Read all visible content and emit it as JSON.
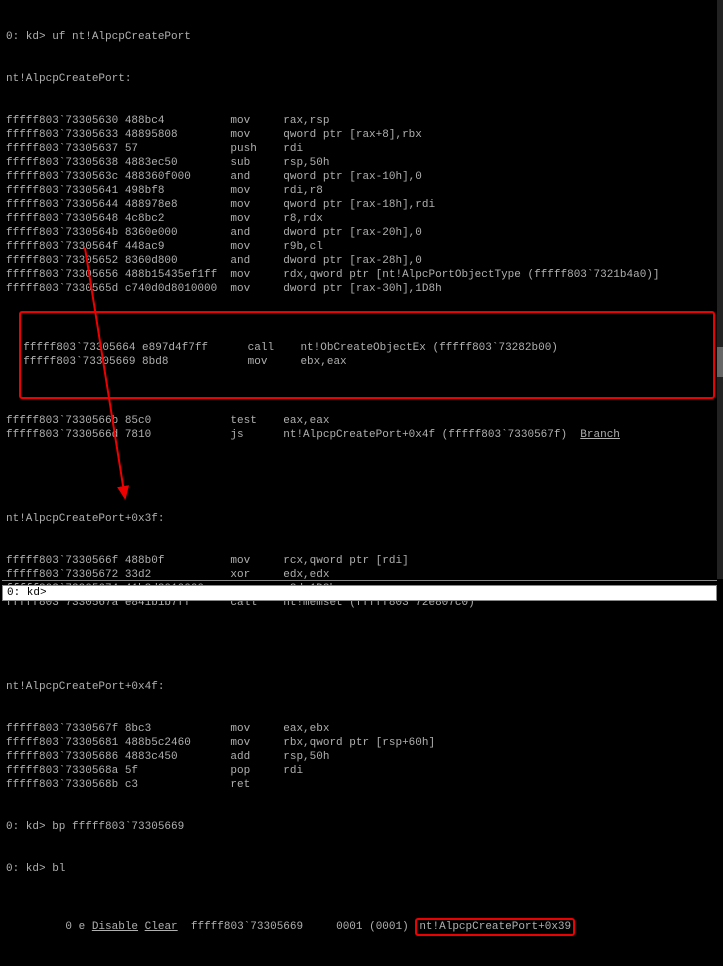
{
  "prompt0": "0: kd> uf nt!AlpcpCreatePort",
  "header": "nt!AlpcpCreatePort:",
  "rows": [
    {
      "addr": "fffff803`73305630",
      "bytes": "488bc4",
      "mn": "mov",
      "ops": "rax,rsp"
    },
    {
      "addr": "fffff803`73305633",
      "bytes": "48895808",
      "mn": "mov",
      "ops": "qword ptr [rax+8],rbx"
    },
    {
      "addr": "fffff803`73305637",
      "bytes": "57",
      "mn": "push",
      "ops": "rdi"
    },
    {
      "addr": "fffff803`73305638",
      "bytes": "4883ec50",
      "mn": "sub",
      "ops": "rsp,50h"
    },
    {
      "addr": "fffff803`7330563c",
      "bytes": "488360f000",
      "mn": "and",
      "ops": "qword ptr [rax-10h],0"
    },
    {
      "addr": "fffff803`73305641",
      "bytes": "498bf8",
      "mn": "mov",
      "ops": "rdi,r8"
    },
    {
      "addr": "fffff803`73305644",
      "bytes": "488978e8",
      "mn": "mov",
      "ops": "qword ptr [rax-18h],rdi"
    },
    {
      "addr": "fffff803`73305648",
      "bytes": "4c8bc2",
      "mn": "mov",
      "ops": "r8,rdx"
    },
    {
      "addr": "fffff803`7330564b",
      "bytes": "8360e000",
      "mn": "and",
      "ops": "dword ptr [rax-20h],0"
    },
    {
      "addr": "fffff803`7330564f",
      "bytes": "448ac9",
      "mn": "mov",
      "ops": "r9b,cl"
    },
    {
      "addr": "fffff803`73305652",
      "bytes": "8360d800",
      "mn": "and",
      "ops": "dword ptr [rax-28h],0"
    },
    {
      "addr": "fffff803`73305656",
      "bytes": "488b15435ef1ff",
      "mn": "mov",
      "ops": "rdx,qword ptr [nt!AlpcPortObjectType (fffff803`7321b4a0)]"
    },
    {
      "addr": "fffff803`7330565d",
      "bytes": "c740d0d8010000",
      "mn": "mov",
      "ops": "dword ptr [rax-30h],1D8h"
    }
  ],
  "box1": [
    {
      "addr": "fffff803`73305664",
      "bytes": "e897d4f7ff",
      "mn": "call",
      "ops": "nt!ObCreateObjectEx (fffff803`73282b00)"
    },
    {
      "addr": "fffff803`73305669",
      "bytes": "8bd8",
      "mn": "mov",
      "ops": "ebx,eax"
    }
  ],
  "rows2": [
    {
      "addr": "fffff803`7330566b",
      "bytes": "85c0",
      "mn": "test",
      "ops": "eax,eax"
    },
    {
      "addr": "fffff803`7330566d",
      "bytes": "7810",
      "mn": "js",
      "ops": "nt!AlpcpCreatePort+0x4f (fffff803`7330567f)",
      "branch": true
    }
  ],
  "label3f": "nt!AlpcpCreatePort+0x3f:",
  "rows3": [
    {
      "addr": "fffff803`7330566f",
      "bytes": "488b0f",
      "mn": "mov",
      "ops": "rcx,qword ptr [rdi]"
    },
    {
      "addr": "fffff803`73305672",
      "bytes": "33d2",
      "mn": "xor",
      "ops": "edx,edx"
    },
    {
      "addr": "fffff803`73305674",
      "bytes": "41b8d8010000",
      "mn": "mov",
      "ops": "r8d,1D8h"
    },
    {
      "addr": "fffff803`7330567a",
      "bytes": "e841b1b7ff",
      "mn": "call",
      "ops": "nt!memset (fffff803`72e807c0)"
    }
  ],
  "label4f": "nt!AlpcpCreatePort+0x4f:",
  "rows4": [
    {
      "addr": "fffff803`7330567f",
      "bytes": "8bc3",
      "mn": "mov",
      "ops": "eax,ebx"
    },
    {
      "addr": "fffff803`73305681",
      "bytes": "488b5c2460",
      "mn": "mov",
      "ops": "rbx,qword ptr [rsp+60h]"
    },
    {
      "addr": "fffff803`73305686",
      "bytes": "4883c450",
      "mn": "add",
      "ops": "rsp,50h"
    },
    {
      "addr": "fffff803`7330568a",
      "bytes": "5f",
      "mn": "pop",
      "ops": "rdi"
    },
    {
      "addr": "fffff803`7330568b",
      "bytes": "c3",
      "mn": "ret",
      "ops": ""
    }
  ],
  "bpcmd": "0: kd> bp fffff803`73305669",
  "blcmd": "0: kd> bl",
  "bl": {
    "prefix": "     0 e ",
    "disable": "Disable",
    "clear": "Clear",
    "mid": "  fffff803`73305669     0001 (0001) ",
    "sym": "nt!AlpcpCreatePort+0x39"
  },
  "input_prompt": "0: kd>",
  "branch_label": "Branch"
}
